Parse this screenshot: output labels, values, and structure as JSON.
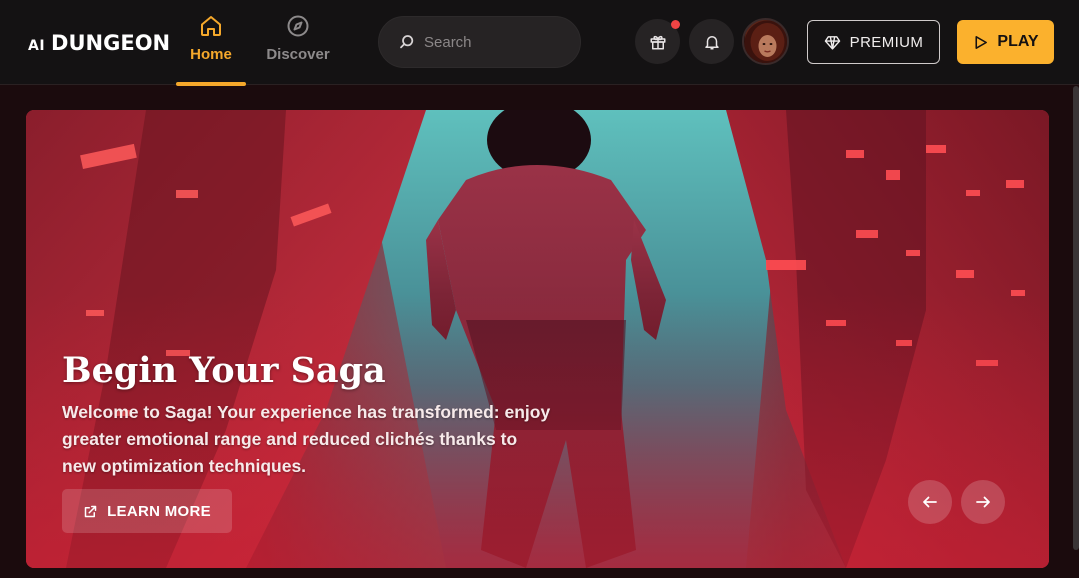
{
  "header": {
    "logo_prefix": "AI",
    "logo_text": "DUNGEON",
    "nav": [
      {
        "label": "Home",
        "icon": "home-icon",
        "active": true
      },
      {
        "label": "Discover",
        "icon": "compass-icon",
        "active": false
      }
    ],
    "search_placeholder": "Search",
    "premium_label": "PREMIUM",
    "play_label": "PLAY",
    "accent_color": "#fbb12d",
    "notification_dot_color": "#ef4444"
  },
  "hero": {
    "title": "Begin Your Saga",
    "description": "Welcome to Saga! Your experience has transformed: enjoy greater emotional range and reduced clichés thanks to new optimization techniques.",
    "cta_label": "LEARN MORE"
  }
}
